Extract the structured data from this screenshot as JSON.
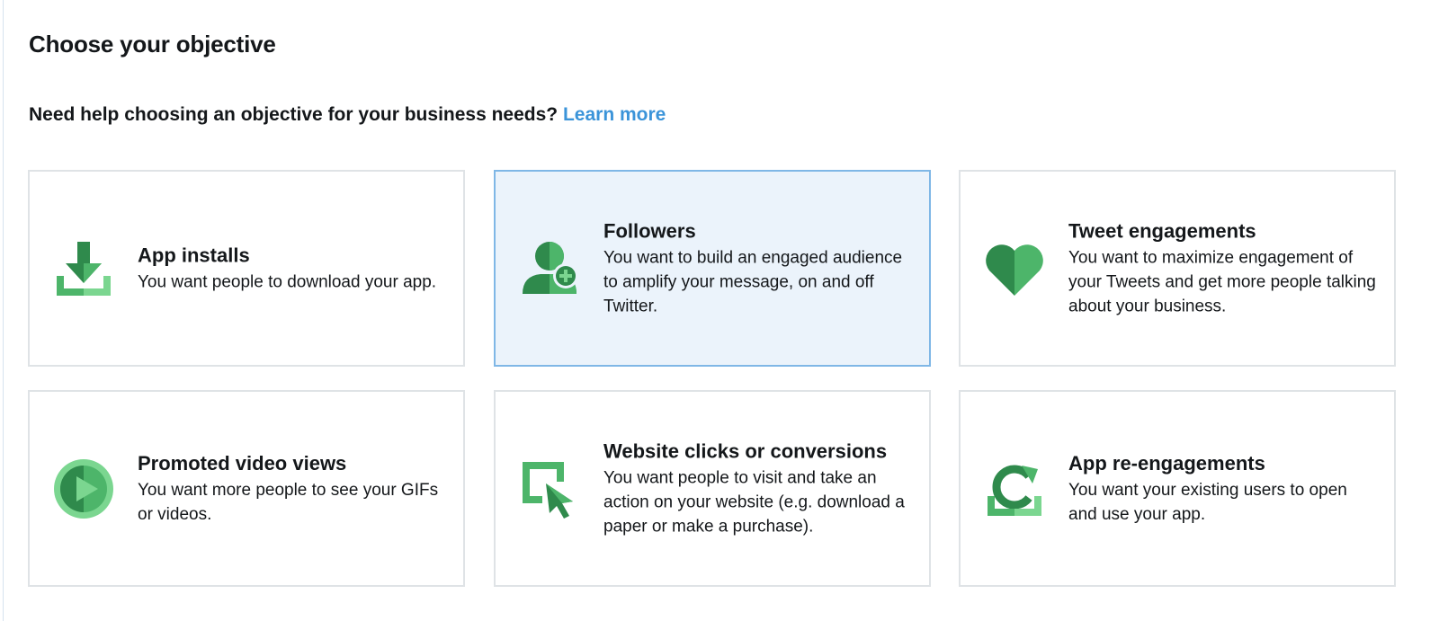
{
  "page": {
    "title": "Choose your objective",
    "help_text": "Need help choosing an objective for your business needs?",
    "help_link": "Learn more"
  },
  "colors": {
    "accent_link": "#3b94d9",
    "icon_green_dark": "#2f8a4c",
    "icon_green": "#4db56a",
    "icon_green_light": "#7bd690",
    "selected_bg": "#ebf3fb",
    "selected_border": "#7fb7e6"
  },
  "objectives": [
    {
      "icon": "download-icon",
      "title": "App installs",
      "description": "You want people to download your app.",
      "selected": false
    },
    {
      "icon": "add-follower-icon",
      "title": "Followers",
      "description": "You want to build an engaged audience to amplify your message, on and off Twitter.",
      "selected": true
    },
    {
      "icon": "heart-icon",
      "title": "Tweet engagements",
      "description": "You want to maximize engagement of your Tweets and get more people talking about your business.",
      "selected": false
    },
    {
      "icon": "play-video-icon",
      "title": "Promoted video views",
      "description": "You want more people to see your GIFs or videos.",
      "selected": false
    },
    {
      "icon": "cursor-click-icon",
      "title": "Website clicks or conversions",
      "description": "You want people to visit and take an action on your website (e.g. download a paper or make a purchase).",
      "selected": false
    },
    {
      "icon": "refresh-app-icon",
      "title": "App re-engagements",
      "description": "You want your existing users to open and use your app.",
      "selected": false
    }
  ]
}
